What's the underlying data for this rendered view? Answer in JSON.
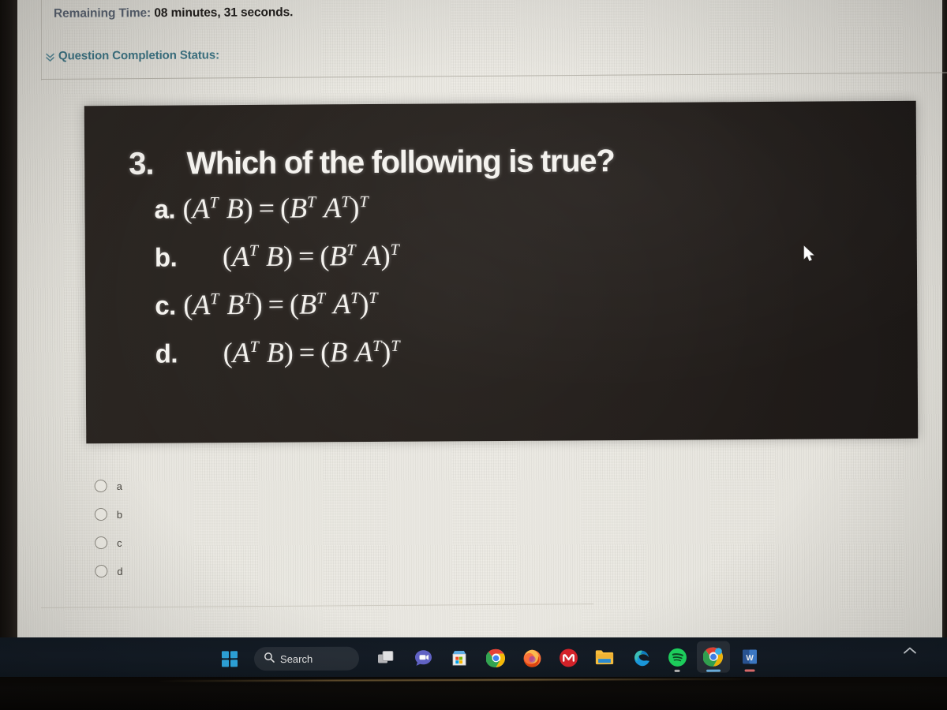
{
  "header": {
    "remaining_time_label": "Remaining Time:",
    "remaining_time_value": "08 minutes, 31 seconds.",
    "completion_status_label": "Question Completion Status:",
    "collapse_icon": "double-chevron-down-icon"
  },
  "question": {
    "number": "3.",
    "prompt": "Which of the following is true?",
    "options": [
      {
        "letter": "a.",
        "spacing": "tight",
        "equation_plain": "(A^T B) = (B^T A^T)^T",
        "lhs": {
          "open": "(",
          "terms": [
            {
              "base": "A",
              "sup": "T"
            },
            {
              "base": "B",
              "sup": ""
            }
          ],
          "close": ")",
          "sup": ""
        },
        "op": "=",
        "rhs": {
          "open": "(",
          "terms": [
            {
              "base": "B",
              "sup": "T"
            },
            {
              "base": "A",
              "sup": "T"
            }
          ],
          "close": ")",
          "sup": "T"
        }
      },
      {
        "letter": "b.",
        "spacing": "wide",
        "equation_plain": "(A^T B) = (B^T A)^T",
        "lhs": {
          "open": "(",
          "terms": [
            {
              "base": "A",
              "sup": "T"
            },
            {
              "base": "B",
              "sup": ""
            }
          ],
          "close": ")",
          "sup": ""
        },
        "op": "=",
        "rhs": {
          "open": "(",
          "terms": [
            {
              "base": "B",
              "sup": "T"
            },
            {
              "base": "A",
              "sup": ""
            }
          ],
          "close": ")",
          "sup": "T"
        }
      },
      {
        "letter": "c.",
        "spacing": "tight",
        "equation_plain": "(A^T B^T) = (B^T A^T)^T",
        "lhs": {
          "open": "(",
          "terms": [
            {
              "base": "A",
              "sup": "T"
            },
            {
              "base": "B",
              "sup": "T"
            }
          ],
          "close": ")",
          "sup": ""
        },
        "op": "=",
        "rhs": {
          "open": "(",
          "terms": [
            {
              "base": "B",
              "sup": "T"
            },
            {
              "base": "A",
              "sup": "T"
            }
          ],
          "close": ")",
          "sup": "T"
        }
      },
      {
        "letter": "d.",
        "spacing": "wide",
        "equation_plain": "(A^T B) = (BA^T)^T",
        "lhs": {
          "open": "(",
          "terms": [
            {
              "base": "A",
              "sup": "T"
            },
            {
              "base": "B",
              "sup": ""
            }
          ],
          "close": ")",
          "sup": ""
        },
        "op": "=",
        "rhs": {
          "open": "(",
          "terms": [
            {
              "base": "B",
              "sup": ""
            },
            {
              "base": "A",
              "sup": "T"
            }
          ],
          "close": ")",
          "sup": "T"
        }
      }
    ]
  },
  "answers": {
    "options": [
      {
        "label": "a",
        "selected": false
      },
      {
        "label": "b",
        "selected": false
      },
      {
        "label": "c",
        "selected": false
      },
      {
        "label": "d",
        "selected": false
      }
    ]
  },
  "taskbar": {
    "start_icon": "windows-logo-icon",
    "search_icon": "search-icon",
    "search_label": "Search",
    "items": [
      {
        "name": "task-view-icon",
        "running": false
      },
      {
        "name": "chat-teams-icon",
        "running": false
      },
      {
        "name": "microsoft-store-icon",
        "running": false
      },
      {
        "name": "google-chrome-icon",
        "running": false
      },
      {
        "name": "firefox-icon",
        "running": false
      },
      {
        "name": "mendeley-icon",
        "running": false
      },
      {
        "name": "file-explorer-icon",
        "running": false
      },
      {
        "name": "microsoft-edge-icon",
        "running": false
      },
      {
        "name": "spotify-icon",
        "running": true
      },
      {
        "name": "google-chrome-active-icon",
        "running": true
      },
      {
        "name": "microsoft-word-icon",
        "running": true
      }
    ],
    "tray": {
      "show_hidden_icon": "chevron-up-icon"
    }
  },
  "cursor": {
    "icon": "mouse-pointer-icon"
  },
  "colors": {
    "page_background": "#eae8e1",
    "panel_background": "#262120",
    "panel_text": "#f4f2ee",
    "time_label": "#5b6472",
    "time_value": "#221f1d",
    "status_teal": "#3e7585",
    "taskbar": "#141c26",
    "accent_blue": "#2fa8e0"
  }
}
